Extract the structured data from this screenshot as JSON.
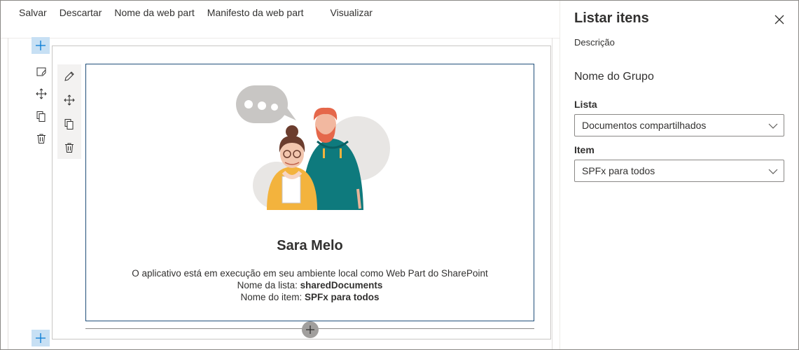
{
  "toolbar": {
    "save": "Salvar",
    "discard": "Descartar",
    "webpart_name": "Nome da web part",
    "webpart_manifest": "Manifesto da web part",
    "preview": "Visualizar"
  },
  "webpart": {
    "user_name": "Sara Melo",
    "line1": "O aplicativo está em execução em seu ambiente local como Web Part do SharePoint",
    "list_label": "Nome da lista: ",
    "list_value": "sharedDocuments",
    "item_label": "Nome do item: ",
    "item_value": "SPFx para todos"
  },
  "pane": {
    "title": "Listar itens",
    "description": "Descrição",
    "group_name": "Nome do Grupo",
    "list_field": {
      "label": "Lista",
      "value": "Documentos compartilhados"
    },
    "item_field": {
      "label": "Item",
      "value": "SPFx para todos"
    }
  },
  "icons": {
    "add": "plus-icon",
    "edit_section": "edit-section-icon",
    "move": "move-icon",
    "copy": "copy-icon",
    "delete": "delete-icon",
    "edit_webpart": "pencil-icon",
    "close": "close-icon",
    "chevron": "chevron-down-icon"
  },
  "colors": {
    "accent_light": "#c7e0f4",
    "webpart_border": "#1f4e79",
    "teal": "#0e7a7d",
    "mustard": "#f3b33d"
  }
}
